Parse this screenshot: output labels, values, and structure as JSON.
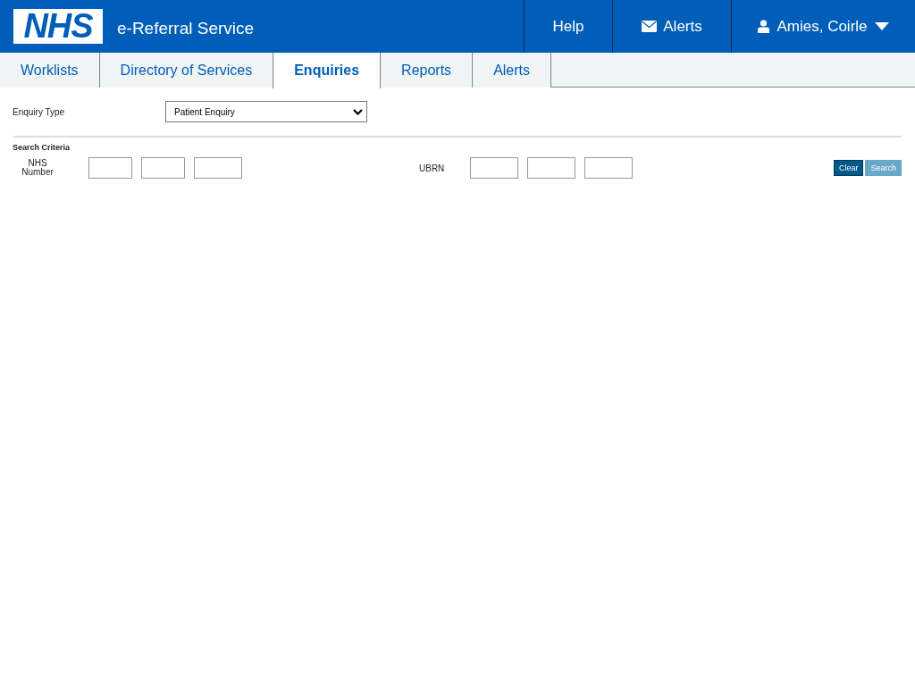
{
  "header": {
    "logo": "NHS",
    "title": "e-Referral Service",
    "nav": [
      {
        "kind": "help",
        "label": "Help"
      },
      {
        "kind": "alerts",
        "label": "Alerts"
      },
      {
        "kind": "user",
        "label": "Amies, Coirle"
      }
    ]
  },
  "tabs": [
    {
      "label": "Worklists",
      "selected": false
    },
    {
      "label": "Directory of Services",
      "selected": false
    },
    {
      "label": "Enquiries",
      "selected": true
    },
    {
      "label": "Reports",
      "selected": false
    },
    {
      "label": "Alerts",
      "selected": false
    }
  ],
  "enquiry_type": {
    "label": "Enquiry Type",
    "value": "Patient Enquiry"
  },
  "search_criteria": {
    "heading": "Search Criteria",
    "nhs_number": {
      "label": "NHS Number"
    },
    "ubrn": {
      "label": "UBRN"
    }
  },
  "buttons": [
    {
      "label": "Clear",
      "disabled": false
    },
    {
      "label": "Search",
      "disabled": true
    }
  ]
}
